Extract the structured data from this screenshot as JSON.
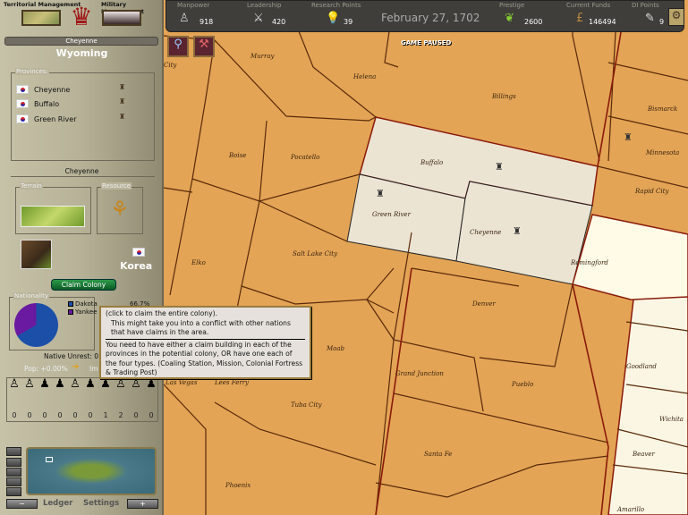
{
  "management": {
    "territorial": "Territorial Management",
    "military": "Military Management"
  },
  "selected_province_box": "Cheyenne",
  "colony_name": "Wyoming",
  "provinces": {
    "title": "Provinces:",
    "items": [
      {
        "name": "Cheyenne"
      },
      {
        "name": "Buffalo"
      },
      {
        "name": "Green River"
      }
    ]
  },
  "province_heading": "Cheyenne",
  "terrain_label": "Terrain",
  "resource_label": "Resource",
  "owner": "Korea",
  "claim_button": "Claim Colony",
  "nationality": {
    "title": "Nationality",
    "items": [
      {
        "name": "Dakota",
        "pct": "66.7%",
        "color": "#1c4fa8"
      },
      {
        "name": "Yankee",
        "color": "#6a1aa0"
      }
    ]
  },
  "native_unrest": "Native Unrest: 0",
  "pop_growth": "Pop: +0.00%",
  "immigration": "Im",
  "pop_counts": [
    "0",
    "0",
    "0",
    "0",
    "0",
    "0",
    "1",
    "2",
    "0",
    "0"
  ],
  "bottom": {
    "ledger": "Ledger",
    "settings": "Settings"
  },
  "topbar": {
    "manpower": {
      "label": "Manpower",
      "value": "918"
    },
    "leadership": {
      "label": "Leadership",
      "value": "420"
    },
    "research": {
      "label": "Research Points",
      "value": "39"
    },
    "date": "February 27, 1702",
    "prestige": {
      "label": "Prestige",
      "value": "2600"
    },
    "funds": {
      "label": "Current Funds",
      "value": "146494"
    },
    "di": {
      "label": "DI Points",
      "value": "9"
    }
  },
  "game_paused": "GAME PAUSED",
  "tooltip": {
    "line1": "(click to claim the entire colony).",
    "line2": "This might take you into a conflict with other nations that have claims in the area.",
    "line3": "You need to have either a claim building in each of the provinces in the potential colony, OR have one each of the four types. (Coaling Station, Mission, Colonial Fortress & Trading Post)"
  },
  "map_labels": [
    "City",
    "Murray",
    "Helena",
    "Billings",
    "Bismarck",
    "Minnesota",
    "Boise",
    "Pocatello",
    "Buffalo",
    "Green River",
    "Cheyenne",
    "Rapid City",
    "Remingford",
    "Elko",
    "Salt Lake City",
    "Denver",
    "Moab",
    "Grand Junction",
    "Pueblo",
    "Las Vegas",
    "Lees Ferry",
    "Tuba City",
    "Santa Fe",
    "Phoenix",
    "Goodland",
    "Wichita",
    "Beaver",
    "Amarillo"
  ]
}
